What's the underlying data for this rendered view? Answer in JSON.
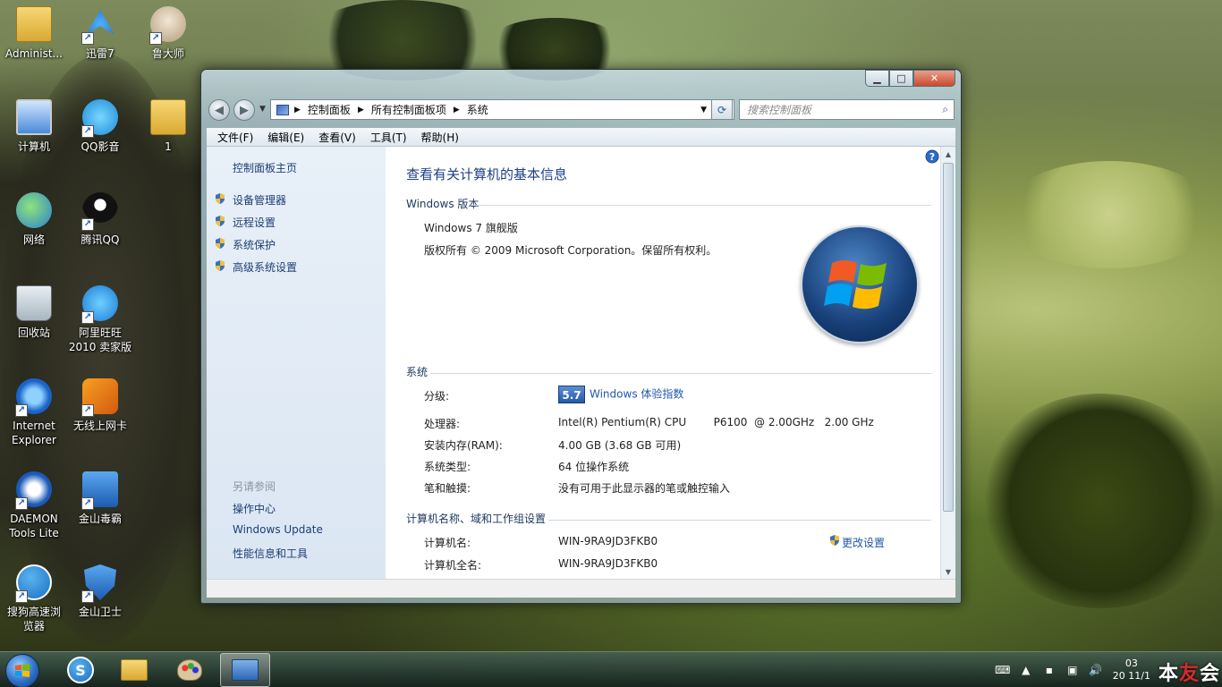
{
  "desktop": {
    "icons": [
      {
        "label": "Administ...",
        "icon": "user-folder-icon"
      },
      {
        "label": "迅雷7",
        "icon": "xunlei-icon"
      },
      {
        "label": "鲁大师",
        "icon": "ludashi-icon"
      },
      {
        "label": "计算机",
        "icon": "computer-icon"
      },
      {
        "label": "QQ影音",
        "icon": "qq-player-icon"
      },
      {
        "label": "1",
        "icon": "folder-icon"
      },
      {
        "label": "网络",
        "icon": "network-icon"
      },
      {
        "label": "腾讯QQ",
        "icon": "qq-penguin-icon"
      },
      {
        "label": "回收站",
        "icon": "recycle-bin-icon"
      },
      {
        "label": "阿里旺旺\n2010 卖家版",
        "icon": "aliwangwang-icon"
      },
      {
        "label": "Internet\nExplorer",
        "icon": "ie-icon"
      },
      {
        "label": "无线上网卡",
        "icon": "wireless-card-icon"
      },
      {
        "label": "DAEMON\nTools Lite",
        "icon": "daemon-tools-icon"
      },
      {
        "label": "金山毒霸",
        "icon": "kingsoft-antivirus-icon"
      },
      {
        "label": "搜狗高速浏\n览器",
        "icon": "sogou-browser-icon"
      },
      {
        "label": "金山卫士",
        "icon": "kingsoft-guard-icon"
      }
    ]
  },
  "window": {
    "address": {
      "segments": [
        "控制面板",
        "所有控制面板项",
        "系统"
      ]
    },
    "search_placeholder": "搜索控制面板",
    "menu": [
      "文件(F)",
      "编辑(E)",
      "查看(V)",
      "工具(T)",
      "帮助(H)"
    ],
    "left_pane": {
      "home": "控制面板主页",
      "links": [
        "设备管理器",
        "远程设置",
        "系统保护",
        "高级系统设置"
      ],
      "see_also_heading": "另请参阅",
      "see_also": [
        "操作中心",
        "Windows Update",
        "性能信息和工具"
      ]
    },
    "main": {
      "title": "查看有关计算机的基本信息",
      "edition_heading": "Windows 版本",
      "edition": "Windows 7 旗舰版",
      "copyright": "版权所有 © 2009 Microsoft Corporation。保留所有权利。",
      "system_heading": "系统",
      "rating_label": "分级:",
      "rating_score": "5.7",
      "rating_link": "Windows 体验指数",
      "processor_label": "处理器:",
      "processor_value": "Intel(R) Pentium(R) CPU        P6100  @ 2.00GHz   2.00 GHz",
      "ram_label": "安装内存(RAM):",
      "ram_value": "4.00 GB (3.68 GB 可用)",
      "systype_label": "系统类型:",
      "systype_value": "64 位操作系统",
      "pen_label": "笔和触摸:",
      "pen_value": "没有可用于此显示器的笔或触控输入",
      "computer_heading": "计算机名称、域和工作组设置",
      "computer_name_label": "计算机名:",
      "computer_name_value": "WIN-9RA9JD3FKB0",
      "change_settings": "更改设置",
      "full_name_label": "计算机全名:",
      "full_name_value": "WIN-9RA9JD3FKB0"
    }
  },
  "taskbar": {
    "items": [
      "start-orb",
      "sogou-browser-icon",
      "explorer-folder-icon",
      "control-panel-paint-icon",
      "system-window-icon"
    ],
    "clock_line1": "03",
    "clock_line2": "20",
    "clock_partial": "11/1"
  },
  "watermark": {
    "part1": "本",
    "part2": "友",
    "part3": "会"
  },
  "colors": {
    "accent": "#1e57a8",
    "title_blue": "#1e3f87",
    "left_pane": "#e8f0f8"
  }
}
